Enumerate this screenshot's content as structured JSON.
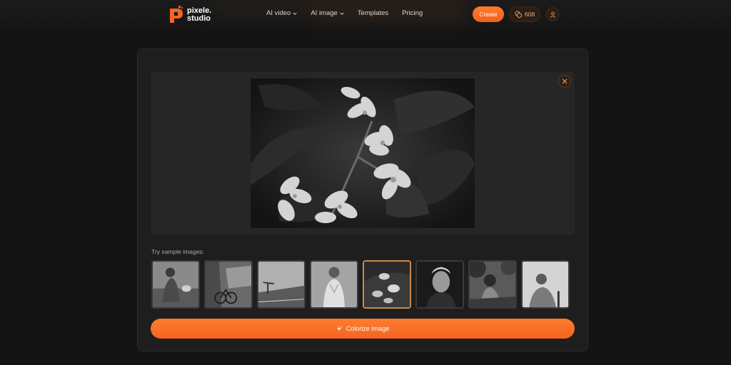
{
  "header": {
    "logo": {
      "line1": "pixele.",
      "line2": "studio"
    },
    "nav": [
      {
        "label": "AI video",
        "has_dropdown": true
      },
      {
        "label": "AI image",
        "has_dropdown": true
      },
      {
        "label": "Templates",
        "has_dropdown": false
      },
      {
        "label": "Pricing",
        "has_dropdown": false
      }
    ],
    "create_label": "Create",
    "credits": "608",
    "accent_color": "#f46520"
  },
  "main": {
    "preview": {
      "mode": "grayscale",
      "close_icon": "close-icon"
    },
    "sample_label": "Try sample images:",
    "samples": [
      {
        "subject": "woman with dog",
        "selected": false
      },
      {
        "subject": "bicycle street",
        "selected": false
      },
      {
        "subject": "architecture",
        "selected": false
      },
      {
        "subject": "woman portrait",
        "selected": false
      },
      {
        "subject": "flowers",
        "selected": true
      },
      {
        "subject": "elderly woman",
        "selected": false
      },
      {
        "subject": "girl outdoors",
        "selected": false
      },
      {
        "subject": "man seated",
        "selected": false
      }
    ],
    "colorize_label": "Colorize Image"
  }
}
